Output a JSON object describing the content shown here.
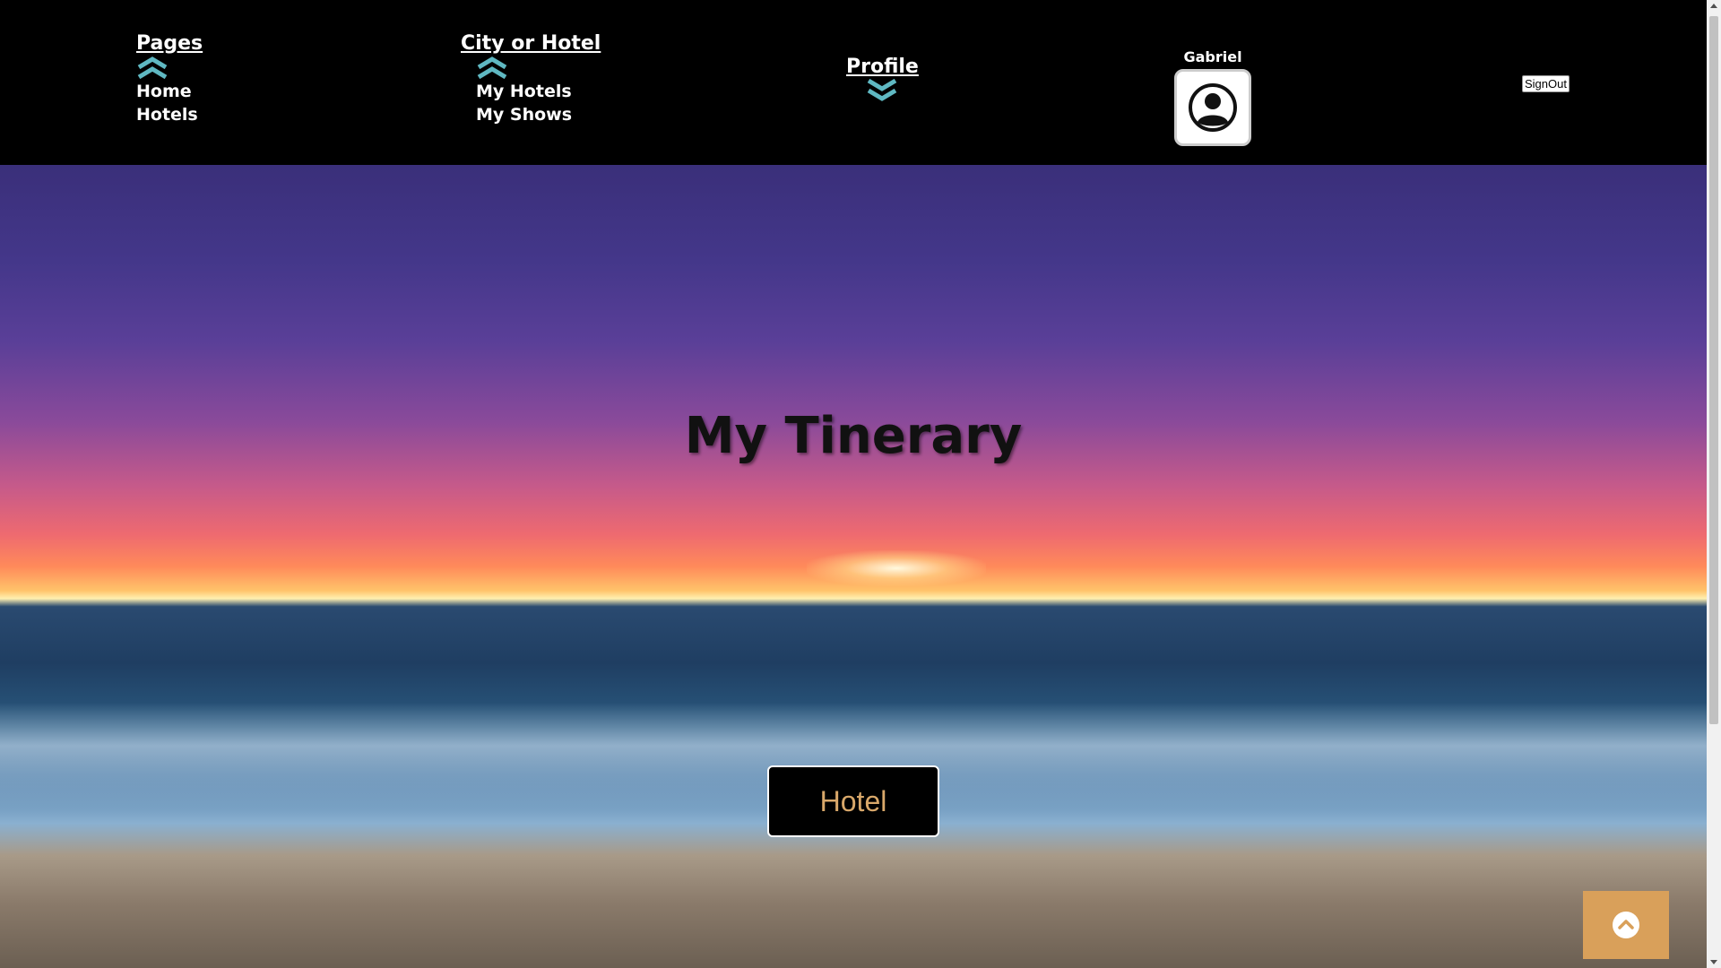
{
  "nav": {
    "pages": {
      "title": "Pages",
      "icon": "chevron-double-up-icon",
      "links": [
        "Home",
        "Hotels"
      ]
    },
    "city_or_hotel": {
      "title": "City or Hotel",
      "icon": "chevron-double-up-icon",
      "links": [
        "My Hotels",
        "My Shows"
      ]
    },
    "profile": {
      "title": "Profile",
      "icon": "chevron-double-down-icon"
    }
  },
  "user": {
    "name": "Gabriel",
    "avatar_icon": "user-circle-icon",
    "signout_label": "SignOut"
  },
  "hero": {
    "title": "My Tinerary",
    "button_label": "Hotel"
  },
  "scroll_top": {
    "icon": "chevron-up-circle-icon"
  },
  "colors": {
    "header_bg": "#000000",
    "chevron": "#5fb8c2",
    "accent": "#d9a05a",
    "button_text": "#d9a86a"
  }
}
